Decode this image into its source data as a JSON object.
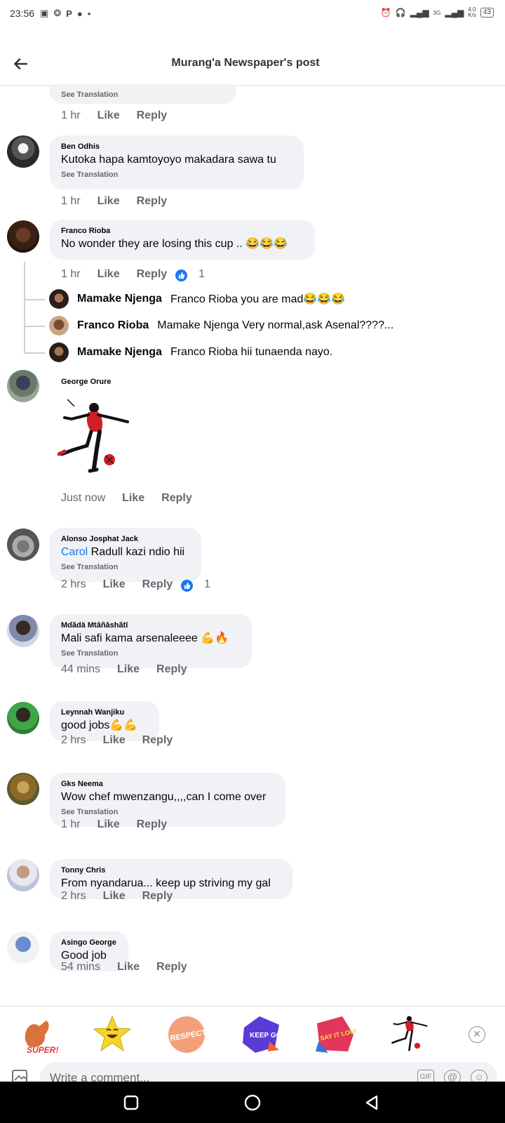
{
  "status": {
    "time": "23:56",
    "battery": "43",
    "net_speed_top": "4.0",
    "net_speed_bottom": "K/s",
    "sim_label": "3G"
  },
  "header": {
    "title": "Murang'a Newspaper's post"
  },
  "see_translation": "See Translation",
  "labels": {
    "like": "Like",
    "reply": "Reply"
  },
  "comments": [
    {
      "author": "",
      "text": "",
      "see_translation": true,
      "time": "1 hr"
    },
    {
      "author": "Ben Odhis",
      "text": "Kutoka hapa kamtoyoyo makadara sawa tu",
      "see_translation": true,
      "time": "1 hr"
    },
    {
      "author": "Franco Rioba",
      "text": "No wonder they are losing this cup .. 😂😂😂",
      "time": "1 hr",
      "likes": "1"
    },
    {
      "author": "George Orure",
      "sticker": "footballer-sticker",
      "time": "Just now"
    },
    {
      "author": "Alonso Josphat Jack",
      "mention": "Carol",
      "text": " Radull kazi ndio hii",
      "see_translation": true,
      "time": "2 hrs",
      "likes": "1"
    },
    {
      "author": "Mdãdä Mtâñâshãtî",
      "text": "Mali safi kama arsenaleeee 💪🔥",
      "see_translation": true,
      "time": "44 mins"
    },
    {
      "author": "Leynnah Wanjiku",
      "text": "good jobs💪💪",
      "time": "2 hrs"
    },
    {
      "author": "Gks Neema",
      "text": "Wow chef mwenzangu,,,,can I come over",
      "see_translation": true,
      "time": "1 hr"
    },
    {
      "author": "Tonny Chris",
      "text": "From nyandarua... keep up striving my gal",
      "time": "2 hrs"
    },
    {
      "author": "Asingo George",
      "text": "Good job",
      "time": "54 mins"
    }
  ],
  "replies": [
    {
      "name": "Mamake Njenga",
      "text": "Franco Rioba you are mad😂😂😂"
    },
    {
      "name": "Franco Rioba",
      "text": "Mamake Njenga Very normal,ask Asenal????..."
    },
    {
      "name": "Mamake Njenga",
      "text": "Franco Rioba hii  tunaenda nayo."
    }
  ],
  "stickers": [
    "super-sticker",
    "laughing-star-sticker",
    "respect-sticker",
    "keep-going-sticker",
    "say-it-loud-sticker",
    "footballer-sticker"
  ],
  "sticker_texts": {
    "super": "SUPER!",
    "respect": "RESPECT",
    "keep_going": "KEEP GOING",
    "say_it_loud": "SAY IT LOUD!"
  },
  "composer": {
    "placeholder": "Write a comment...",
    "gif": "GIF"
  },
  "colors": {
    "bubble": "#f0f2f5",
    "link": "#1877f2",
    "muted": "#65676b"
  }
}
